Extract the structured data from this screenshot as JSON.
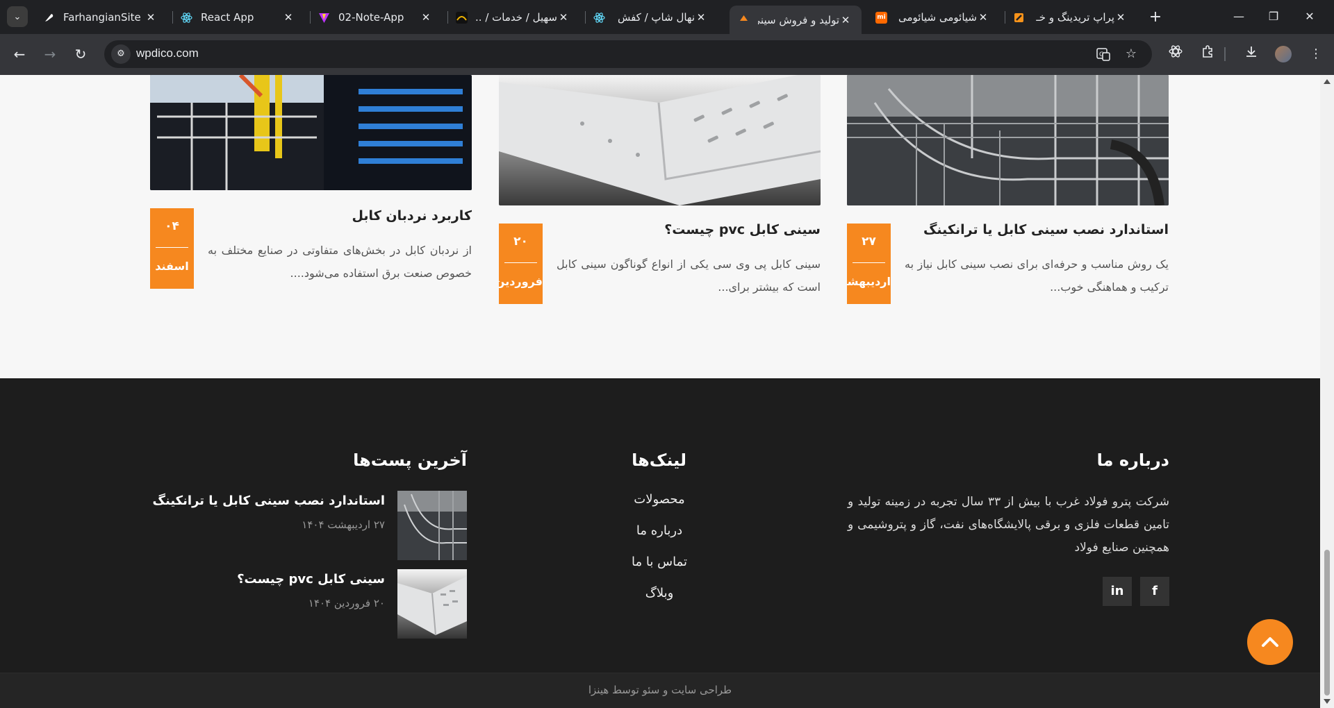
{
  "browser": {
    "tabs": [
      {
        "title": "FarhangianSite -",
        "favicon": "feather-logo-icon",
        "color": "#ffffff"
      },
      {
        "title": "React App",
        "favicon": "react-logo-icon",
        "color": "#61dafb"
      },
      {
        "title": "02-Note-App",
        "favicon": "vite-logo-icon",
        "color": "#bd34fe"
      },
      {
        "title": "سهیل / خدمات / ...",
        "favicon": "site-logo-icon",
        "color": "#f0b400"
      },
      {
        "title": "نهال شاپ / کفش",
        "favicon": "react-logo-icon",
        "color": "#61dafb"
      },
      {
        "title": "تولید و فروش سینی",
        "favicon": "site-logo-icon",
        "color": "#f6881f",
        "active": true
      },
      {
        "title": "شیائومی شیائومی",
        "favicon": "mi-logo-icon",
        "color": "#ff6900"
      },
      {
        "title": "پراپ تریدینگ و خـ",
        "favicon": "site-logo-icon",
        "color": "#f7931a"
      }
    ],
    "url": "wpdico.com",
    "new_tab": "+"
  },
  "posts": [
    {
      "title": "استاندارد نصب سینی کابل یا ترانکینگ",
      "excerpt": "یک روش مناسب و حرفه‌ای برای نصب سینی کابل نیاز به ترکیب و هماهنگی خوب...",
      "day": "۲۷",
      "month": "اردیبهشت",
      "image": "cable-tray-ceiling-photo"
    },
    {
      "title": "سینی کابل pvc چیست؟",
      "excerpt": "سینی کابل پی وی سی یکی از انواع گوناگون سینی کابل است که بیشتر برای...",
      "day": "۲۰",
      "month": "فروردین",
      "image": "pvc-cable-tray-photo"
    },
    {
      "title": "کاربرد نردبان کابل",
      "excerpt": "از نردبان کابل در بخش‌های متفاوتی در صنایع مختلف به خصوص صنعت برق استفاده می‌شود....",
      "day": "۰۴",
      "month": "اسفند",
      "image": "server-rack-cables-photo"
    }
  ],
  "footer": {
    "about_title": "درباره ما",
    "about_text": "شرکت پترو فولاد غرب با بیش از ۳۳ سال تجربه در زمینه تولید و تامین قطعات فلزی و برقی پالایشگاه‌های نفت، گاز و پتروشیمی و همچنین صنایع فولاد",
    "social": [
      {
        "label": "f",
        "icon": "facebook-icon"
      },
      {
        "label": "in",
        "icon": "linkedin-icon"
      }
    ],
    "links_title": "لینک‌ها",
    "links": [
      "محصولات",
      "درباره ما",
      "تماس با ما",
      "وبلاگ"
    ],
    "latest_title": "آخرین پست‌ها",
    "latest": [
      {
        "title": "استاندارد نصب سینی کابل یا ترانکینگ",
        "date": "۲۷ اردیبهشت ۱۴۰۴"
      },
      {
        "title": "سینی کابل pvc چیست؟",
        "date": "۲۰ فروردین ۱۴۰۴"
      }
    ],
    "credit": "طراحی سایت و سئو توسط هینزا"
  },
  "colors": {
    "accent": "#f6881f",
    "footer_bg": "#1d1d1d",
    "page_bg": "#f7f7f7"
  }
}
